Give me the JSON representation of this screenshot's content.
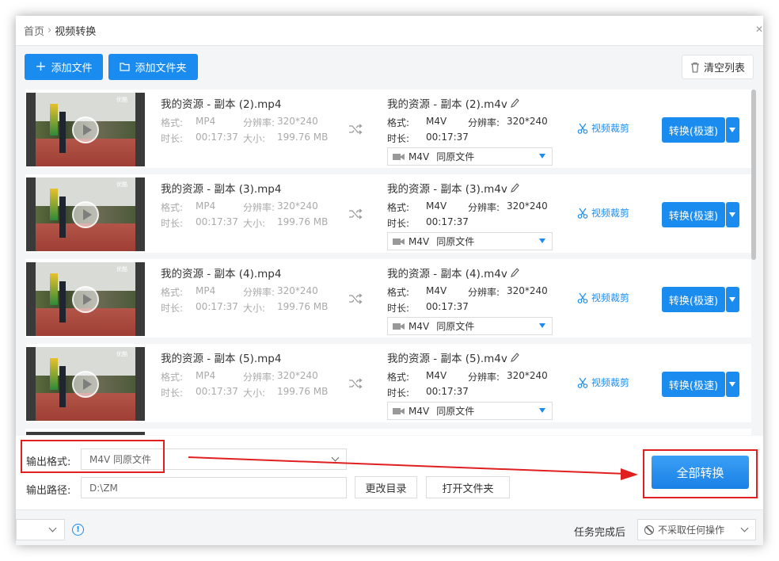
{
  "breadcrumb": {
    "home": "首页",
    "separator": "›",
    "current": "视频转换"
  },
  "toolbar": {
    "add_file": "添加文件",
    "add_folder": "添加文件夹",
    "clear_list": "清空列表"
  },
  "labels": {
    "format": "格式:",
    "resolution": "分辨率:",
    "duration": "时长:",
    "size": "大小:",
    "video_cut": "视频裁剪",
    "convert": "转换(极速)"
  },
  "thumbnail": {
    "watermark": "优酷"
  },
  "items": [
    {
      "src_name": "我的资源 - 副本 (2).mp4",
      "src_format": "MP4",
      "src_resolution": "320*240",
      "src_duration": "00:17:37",
      "src_size": "199.76 MB",
      "out_name": "我的资源 - 副本 (2).m4v",
      "out_format": "M4V",
      "out_resolution": "320*240",
      "out_duration": "00:17:37",
      "select_format": "M4V",
      "select_quality": "同原文件"
    },
    {
      "src_name": "我的资源 - 副本 (3).mp4",
      "src_format": "MP4",
      "src_resolution": "320*240",
      "src_duration": "00:17:37",
      "src_size": "199.76 MB",
      "out_name": "我的资源 - 副本 (3).m4v",
      "out_format": "M4V",
      "out_resolution": "320*240",
      "out_duration": "00:17:37",
      "select_format": "M4V",
      "select_quality": "同原文件"
    },
    {
      "src_name": "我的资源 - 副本 (4).mp4",
      "src_format": "MP4",
      "src_resolution": "320*240",
      "src_duration": "00:17:37",
      "src_size": "199.76 MB",
      "out_name": "我的资源 - 副本 (4).m4v",
      "out_format": "M4V",
      "out_resolution": "320*240",
      "out_duration": "00:17:37",
      "select_format": "M4V",
      "select_quality": "同原文件"
    },
    {
      "src_name": "我的资源 - 副本 (5).mp4",
      "src_format": "MP4",
      "src_resolution": "320*240",
      "src_duration": "00:17:37",
      "src_size": "199.76 MB",
      "out_name": "我的资源 - 副本 (5).m4v",
      "out_format": "M4V",
      "out_resolution": "320*240",
      "out_duration": "00:17:37",
      "select_format": "M4V",
      "select_quality": "同原文件"
    }
  ],
  "bottom": {
    "output_format_label": "输出格式:",
    "output_format_value": "M4V  同原文件",
    "output_path_label": "输出路径:",
    "output_path_value": "D:\\ZM",
    "change_dir": "更改目录",
    "open_folder": "打开文件夹",
    "convert_all": "全部转换"
  },
  "status": {
    "after_task_label": "任务完成后",
    "after_task_value": "不采取任何操作"
  },
  "colors": {
    "accent": "#1a8cf0",
    "highlight": "#e02020"
  }
}
